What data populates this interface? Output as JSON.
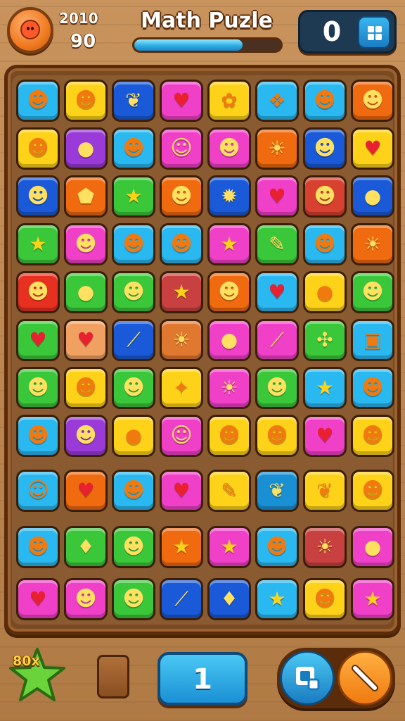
{
  "hud": {
    "stat_top": "2010",
    "stat_bottom": "90",
    "title": "Math Puzle",
    "progress": 0.74,
    "score": "0"
  },
  "board": {
    "rows": [
      [
        {
          "c": "#2ab8f0",
          "g": "☻"
        },
        {
          "c": "#ffd21a",
          "g": "☻"
        },
        {
          "c": "#1a5ad8",
          "g": "❦"
        },
        {
          "c": "#f040c8",
          "g": "♥"
        },
        {
          "c": "#ffd21a",
          "g": "✿"
        },
        {
          "c": "#2ab8f0",
          "g": "❖"
        },
        {
          "c": "#2ab8f0",
          "g": "☻"
        },
        {
          "c": "#f06a10",
          "g": "☻"
        }
      ],
      [
        {
          "c": "#ffd21a",
          "g": "☻"
        },
        {
          "c": "#9a3ad8",
          "g": "●"
        },
        {
          "c": "#2ab8f0",
          "g": "☻"
        },
        {
          "c": "#f040c8",
          "g": "☺"
        },
        {
          "c": "#f040c8",
          "g": "☻"
        },
        {
          "c": "#f06a10",
          "g": "☀"
        },
        {
          "c": "#1a5ad8",
          "g": "☻"
        },
        {
          "c": "#ffd21a",
          "g": "♥"
        }
      ],
      [
        {
          "c": "#1a5ad8",
          "g": "☻"
        },
        {
          "c": "#f06a10",
          "g": "⬟"
        },
        {
          "c": "#3ac83a",
          "g": "★"
        },
        {
          "c": "#f06a10",
          "g": "☻"
        },
        {
          "c": "#1a5ad8",
          "g": "✹"
        },
        {
          "c": "#f040c8",
          "g": "♥"
        },
        {
          "c": "#d84030",
          "g": "☻"
        },
        {
          "c": "#1a5ad8",
          "g": "●"
        }
      ],
      [
        {
          "c": "#3ac83a",
          "g": "★"
        },
        {
          "c": "#f040c8",
          "g": "☻"
        },
        {
          "c": "#2ab8f0",
          "g": "☻"
        },
        {
          "c": "#2ab8f0",
          "g": "☻"
        },
        {
          "c": "#f040c8",
          "g": "★"
        },
        {
          "c": "#3ac83a",
          "g": "✎"
        },
        {
          "c": "#2ab8f0",
          "g": "☻"
        },
        {
          "c": "#f06a10",
          "g": "☀"
        }
      ],
      [
        {
          "c": "#e83020",
          "g": "☻"
        },
        {
          "c": "#3ac83a",
          "g": "●"
        },
        {
          "c": "#3ac83a",
          "g": "☻"
        },
        {
          "c": "#c84040",
          "g": "★"
        },
        {
          "c": "#f06a10",
          "g": "☻"
        },
        {
          "c": "#2ab8f0",
          "g": "♥"
        },
        {
          "c": "#ffd21a",
          "g": "●"
        },
        {
          "c": "#3ac83a",
          "g": "☻"
        }
      ],
      [
        {
          "c": "#3ac83a",
          "g": "♥"
        },
        {
          "c": "#f0a060",
          "g": "♥"
        },
        {
          "c": "#1a5ad8",
          "g": "⟋"
        },
        {
          "c": "#e07830",
          "g": "☀"
        },
        {
          "c": "#f040c8",
          "g": "●"
        },
        {
          "c": "#f040c8",
          "g": "⟋"
        },
        {
          "c": "#3ac83a",
          "g": "✣"
        },
        {
          "c": "#2ab8f0",
          "g": "▣"
        }
      ],
      [
        {
          "c": "#3ac83a",
          "g": "☻"
        },
        {
          "c": "#ffd21a",
          "g": "☻"
        },
        {
          "c": "#3ac83a",
          "g": "☻"
        },
        {
          "c": "#ffd21a",
          "g": "✦"
        },
        {
          "c": "#f040c8",
          "g": "☀"
        },
        {
          "c": "#3ac83a",
          "g": "☻"
        },
        {
          "c": "#2ab8f0",
          "g": "★"
        },
        {
          "c": "#2ab8f0",
          "g": "☻"
        }
      ],
      [
        {
          "c": "#2ab8f0",
          "g": "☻"
        },
        {
          "c": "#9a3ad8",
          "g": "☻"
        },
        {
          "c": "#ffd21a",
          "g": "●"
        },
        {
          "c": "#f040c8",
          "g": "☺"
        },
        {
          "c": "#ffd21a",
          "g": "☻"
        },
        {
          "c": "#ffd21a",
          "g": "☻"
        },
        {
          "c": "#f040c8",
          "g": "♥"
        },
        {
          "c": "#ffd21a",
          "g": "☻"
        }
      ],
      [
        {
          "c": "#2ab8f0",
          "g": "☺"
        },
        {
          "c": "#f06a10",
          "g": "♥"
        },
        {
          "c": "#2ab8f0",
          "g": "☻"
        },
        {
          "c": "#f040c8",
          "g": "♥"
        },
        {
          "c": "#ffd21a",
          "g": "✎"
        },
        {
          "c": "#1a90d4",
          "g": "❦"
        },
        {
          "c": "#ffd21a",
          "g": "❦"
        },
        {
          "c": "#ffd21a",
          "g": "☻"
        }
      ],
      [
        {
          "c": "#2ab8f0",
          "g": "☻"
        },
        {
          "c": "#3ac83a",
          "g": "♦"
        },
        {
          "c": "#3ac83a",
          "g": "☻"
        },
        {
          "c": "#f06a10",
          "g": "★"
        },
        {
          "c": "#f040c8",
          "g": "★"
        },
        {
          "c": "#2ab8f0",
          "g": "☻"
        },
        {
          "c": "#c84040",
          "g": "☀"
        },
        {
          "c": "#f040c8",
          "g": "●"
        }
      ],
      [
        {
          "c": "#f040c8",
          "g": "♥"
        },
        {
          "c": "#f040c8",
          "g": "☻"
        },
        {
          "c": "#3ac83a",
          "g": "☻"
        },
        {
          "c": "#1a5ad8",
          "g": "⟋"
        },
        {
          "c": "#1a5ad8",
          "g": "♦"
        },
        {
          "c": "#2ab8f0",
          "g": "★"
        },
        {
          "c": "#ffd21a",
          "g": "☻"
        },
        {
          "c": "#f040c8",
          "g": "★"
        }
      ]
    ]
  },
  "bottom": {
    "badge_text": "80x",
    "level": "1"
  },
  "icons": {
    "avatar": "avatar-face-icon",
    "grid": "grid-menu-icon",
    "star": "star-badge-icon",
    "hint": "hint-icon",
    "pencil": "pencil-icon"
  }
}
